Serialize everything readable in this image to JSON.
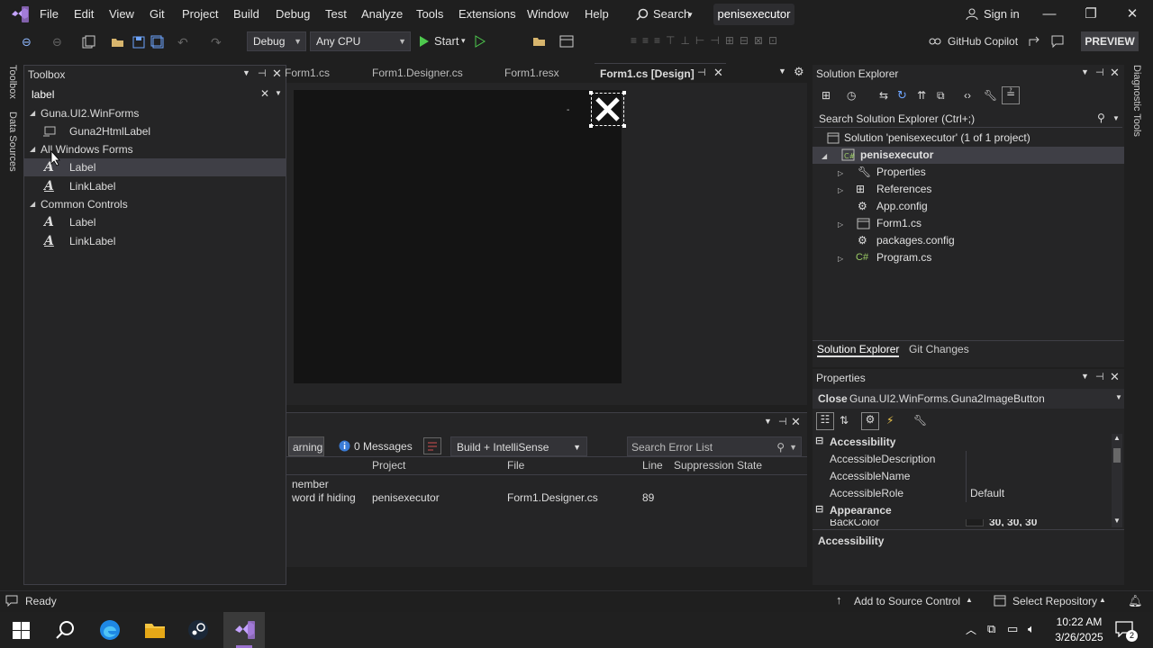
{
  "menu": {
    "items": [
      "File",
      "Edit",
      "View",
      "Git",
      "Project",
      "Build",
      "Debug",
      "Test",
      "Analyze",
      "Tools",
      "Extensions",
      "Window",
      "Help"
    ],
    "search": "Search",
    "solution_name": "penisexecutor",
    "sign_in": "Sign in"
  },
  "toolbar": {
    "config": "Debug",
    "platform": "Any CPU",
    "start": "Start",
    "copilot": "GitHub Copilot",
    "preview": "PREVIEW"
  },
  "side_strips": {
    "left_top": "Toolbox",
    "left_bottom": "Data Sources",
    "right": "Diagnostic Tools"
  },
  "toolbox": {
    "title": "Toolbox",
    "search_value": "label",
    "groups": [
      {
        "name": "Guna.UI2.WinForms",
        "items": [
          "Guna2HtmlLabel"
        ]
      },
      {
        "name": "All Windows Forms",
        "items": [
          "Label",
          "LinkLabel"
        ]
      },
      {
        "name": "Common Controls",
        "items": [
          "Label",
          "LinkLabel"
        ]
      }
    ]
  },
  "doc_tabs": [
    "Form1.cs",
    "Form1.Designer.cs",
    "Form1.resx",
    "Form1.cs [Design]"
  ],
  "error_list": {
    "warning_label": "arning",
    "messages_label": "0 Messages",
    "scope": "Build + IntelliSense",
    "search_placeholder": "Search Error List",
    "columns": [
      "Project",
      "File",
      "Line",
      "Suppression State"
    ],
    "row": {
      "desc_line1": "nember",
      "desc_line2": "word if hiding",
      "project": "penisexecutor",
      "file": "Form1.Designer.cs",
      "line": "89"
    }
  },
  "solution_explorer": {
    "title": "Solution Explorer",
    "search_placeholder": "Search Solution Explorer (Ctrl+;)",
    "solution_label": "Solution 'penisexecutor' (1 of 1 project)",
    "project": "penisexecutor",
    "items": [
      "Properties",
      "References",
      "App.config",
      "Form1.cs",
      "packages.config",
      "Program.cs"
    ],
    "tabs": [
      "Solution Explorer",
      "Git Changes"
    ]
  },
  "properties": {
    "title": "Properties",
    "object_name": "Close",
    "object_type": "Guna.UI2.WinForms.Guna2ImageButton",
    "rows": [
      {
        "name": "Accessibility",
        "value": "",
        "category": true
      },
      {
        "name": "AccessibleDescription",
        "value": ""
      },
      {
        "name": "AccessibleName",
        "value": ""
      },
      {
        "name": "AccessibleRole",
        "value": "Default"
      },
      {
        "name": "Appearance",
        "value": "",
        "category": true
      },
      {
        "name": "BackColor",
        "value": "30, 30, 30"
      }
    ],
    "description_title": "Accessibility"
  },
  "status": {
    "ready": "Ready",
    "source_control": "Add to Source Control",
    "repository": "Select Repository"
  },
  "taskbar": {
    "time": "10:22 AM",
    "date": "3/26/2025",
    "notification_count": "2"
  },
  "colors": {
    "accent": "#9b72cf",
    "play_green": "#4ec94e",
    "bg": "#1f1f1f"
  }
}
